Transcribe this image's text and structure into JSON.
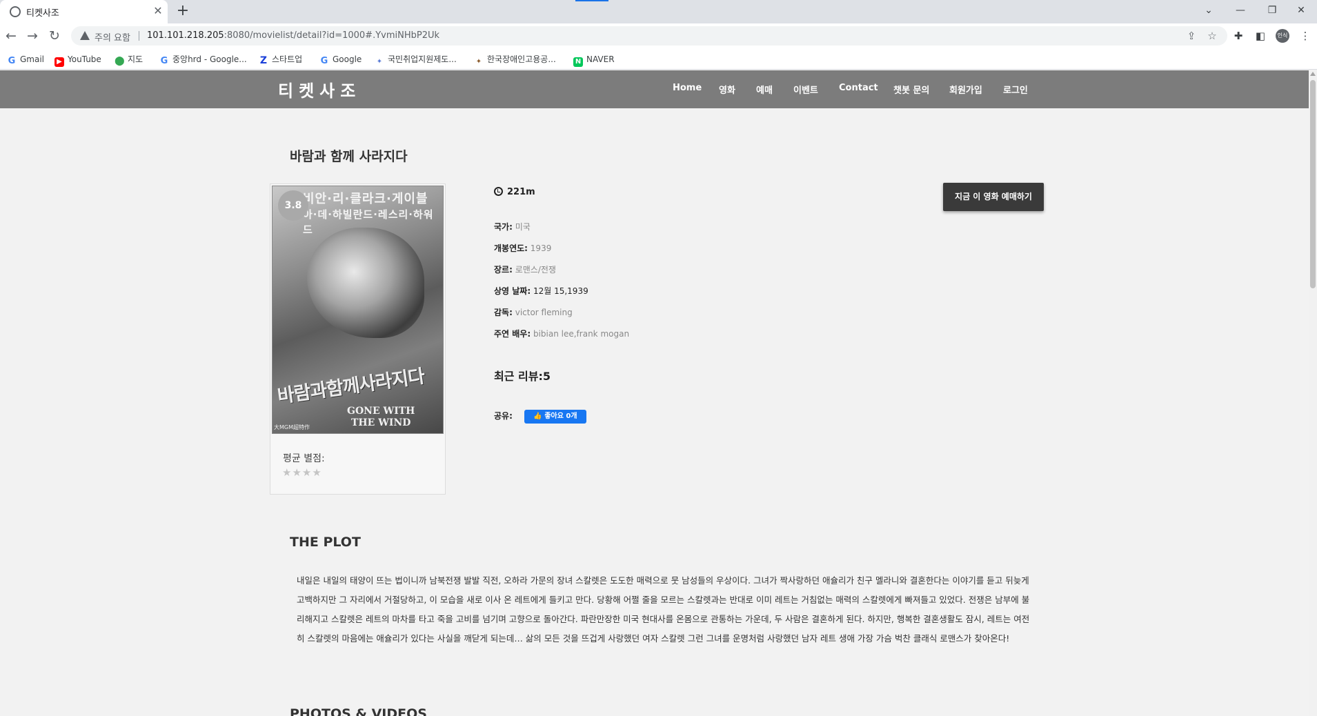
{
  "browser": {
    "tab_title": "티켓사조",
    "new_tab_symbol": "+",
    "close_symbol": "✕",
    "security_warning": "주의 요함",
    "url_host": "101.101.218.205",
    "url_rest": ":8080/movielist/detail?id=1000#.YvmiNHbP2Uk",
    "profile_label": "인식",
    "bookmarks": [
      "Gmail",
      "YouTube",
      "지도",
      "중앙hrd - Google...",
      "스타트업",
      "Google",
      "국민취업지원제도...",
      "한국장애인고용공...",
      "NAVER"
    ]
  },
  "site": {
    "logo": "티켓사조",
    "nav": [
      "Home",
      "영화",
      "예매",
      "이벤트",
      "Contact",
      "챗봇 문의",
      "회원가입",
      "로그인"
    ]
  },
  "movie": {
    "title": "바람과 함께 사라지다",
    "rating": "3.8",
    "avg_label": "평균 별점:",
    "stars": "★★★★",
    "runtime": "221m",
    "book_button": "지금 이 영화 예매하기",
    "info": {
      "country_label": "국가:",
      "country": "미국",
      "year_label": "개봉연도:",
      "year": "1939",
      "genre_label": "장르:",
      "genre": "로맨스/전쟁",
      "release_label": "상영 날짜:",
      "release": "12월 15,1939",
      "director_label": "감독:",
      "director": "victor fleming",
      "cast_label": "주연 배우:",
      "cast": "bibian lee,frank mogan"
    },
    "reviews": "최근 리뷰:5",
    "share_label": "공유:",
    "like_button": "좋아요 0개",
    "poster": {
      "top_text_1": "비안·리·클라크·게이블",
      "top_text_2": "아·데·하빌란드·레스리·하워드",
      "korean_title": "바람과함께사라지다",
      "english_title_1": "GONE WITH",
      "english_title_2": "THE WIND",
      "small_text": "大MGM超特作"
    }
  },
  "plot": {
    "heading": "THE PLOT",
    "text": "내일은 내일의 태양이 뜨는 법이니까 남북전쟁 발발 직전, 오하라 가문의 장녀 스칼렛은 도도한 매력으로 뭇 남성들의 우상이다. 그녀가 짝사랑하던 애슐리가 친구 멜라니와 결혼한다는 이야기를 듣고 뒤늦게 고백하지만 그 자리에서 거절당하고, 이 모습을 새로 이사 온 레트에게 들키고 만다. 당황해 어쩔 줄을 모르는 스칼렛과는 반대로 이미 레트는 거침없는 매력의 스칼렛에게 빠져들고 있었다. 전쟁은 남부에 불리해지고 스칼렛은 레트의 마차를 타고 죽을 고비를 넘기며 고향으로 돌아간다. 파란만장한 미국 현대사를 온몸으로 관통하는 가운데, 두 사람은 결혼하게 된다. 하지만, 행복한 결혼생활도 잠시, 레트는 여전히 스칼렛의 마음에는 애슐리가 있다는 사실을 깨닫게 되는데… 삶의 모든 것을 뜨겁게 사랑했던 여자 스칼렛 그런 그녀를 운명처럼 사랑했던 남자 레트 생애 가장 가슴 벅찬 클래식 로맨스가 찾아온다!"
  },
  "photos": {
    "heading": "PHOTOS & VIDEOS"
  }
}
